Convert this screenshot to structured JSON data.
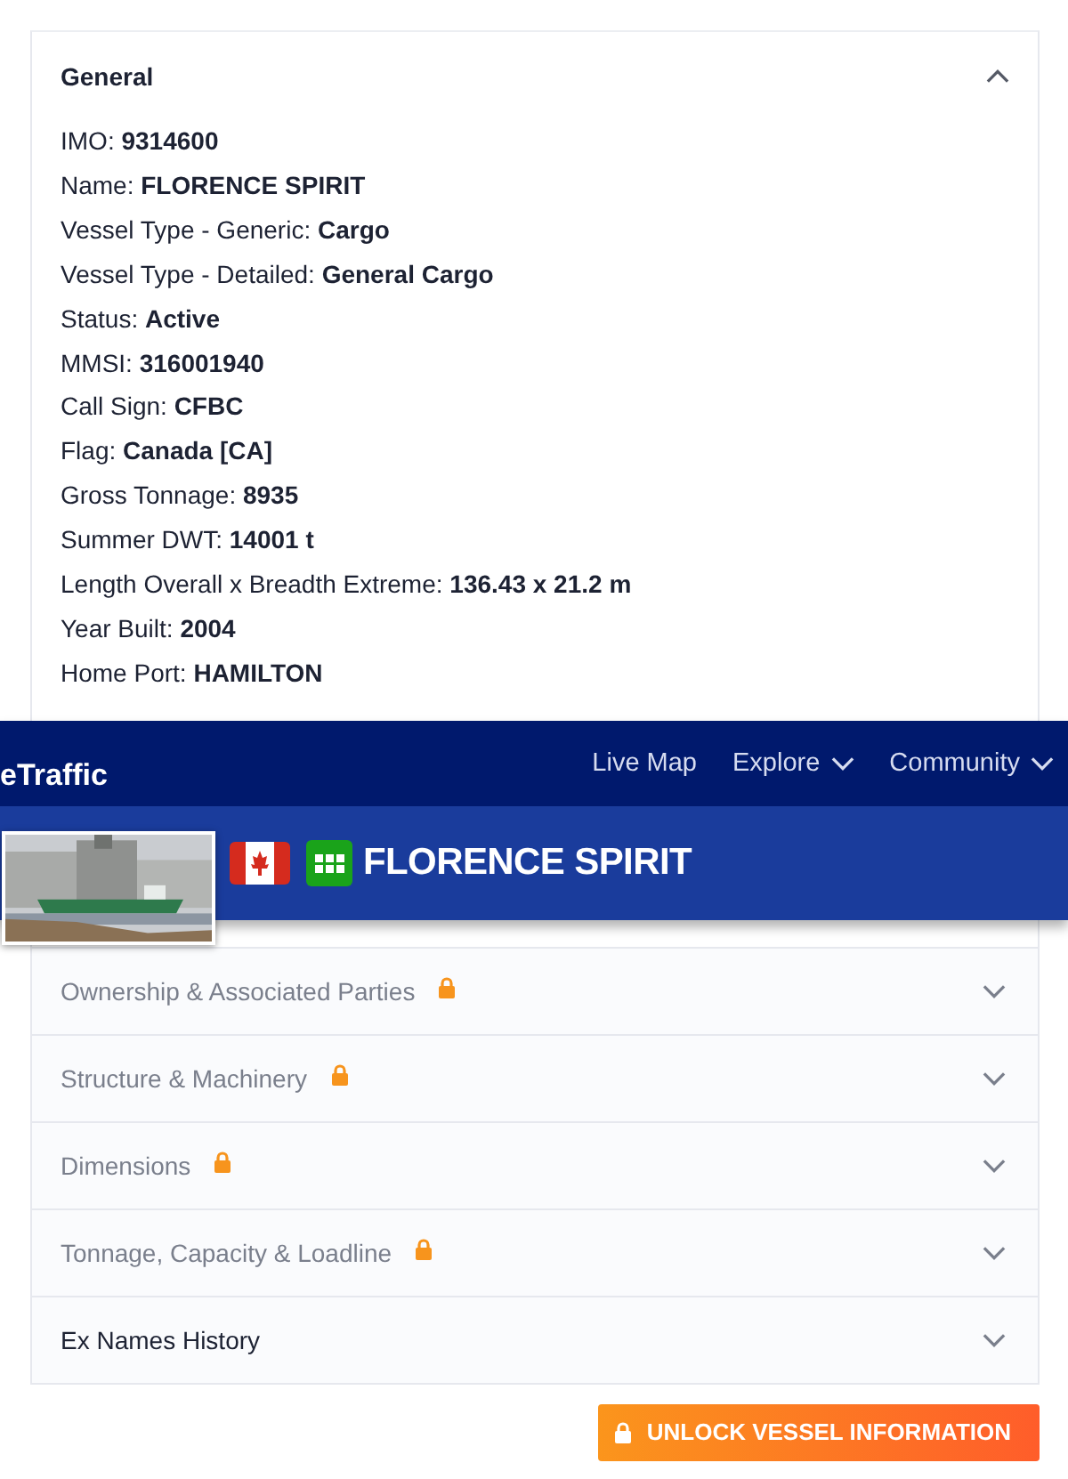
{
  "general": {
    "title": "General",
    "expanded": true,
    "fields": [
      {
        "label": "IMO:",
        "value": "9314600"
      },
      {
        "label": "Name:",
        "value": "FLORENCE SPIRIT"
      },
      {
        "label": "Vessel Type - Generic:",
        "value": "Cargo"
      },
      {
        "label": "Vessel Type - Detailed:",
        "value": "General Cargo"
      },
      {
        "label": "Status:",
        "value": "Active"
      },
      {
        "label": "MMSI:",
        "value": "316001940"
      },
      {
        "label": "Call Sign:",
        "value": "CFBC"
      },
      {
        "label": "Flag:",
        "value": "Canada [CA]"
      },
      {
        "label": "Gross Tonnage:",
        "value": "8935"
      },
      {
        "label": "Summer DWT:",
        "value": "14001 t"
      },
      {
        "label": "Length Overall x Breadth Extreme:",
        "value": "136.43 x 21.2 m"
      },
      {
        "label": "Year Built:",
        "value": "2004"
      },
      {
        "label": "Home Port:",
        "value": "HAMILTON"
      }
    ]
  },
  "sections": [
    {
      "title": "Ownership & Associated Parties",
      "locked": true,
      "expanded": false
    },
    {
      "title": "Structure & Machinery",
      "locked": true,
      "expanded": false
    },
    {
      "title": "Dimensions",
      "locked": true,
      "expanded": false
    },
    {
      "title": "Tonnage, Capacity & Loadline",
      "locked": true,
      "expanded": false
    },
    {
      "title": "Ex Names History",
      "locked": false,
      "expanded": false
    }
  ],
  "unlock_button": {
    "label": "UNLOCK VESSEL INFORMATION"
  },
  "header": {
    "brand": "eTraffic",
    "nav": [
      {
        "label": "Live Map",
        "dropdown": false
      },
      {
        "label": "Explore",
        "dropdown": true
      },
      {
        "label": "Community",
        "dropdown": true
      }
    ],
    "vessel_name": "FLORENCE SPIRIT"
  }
}
